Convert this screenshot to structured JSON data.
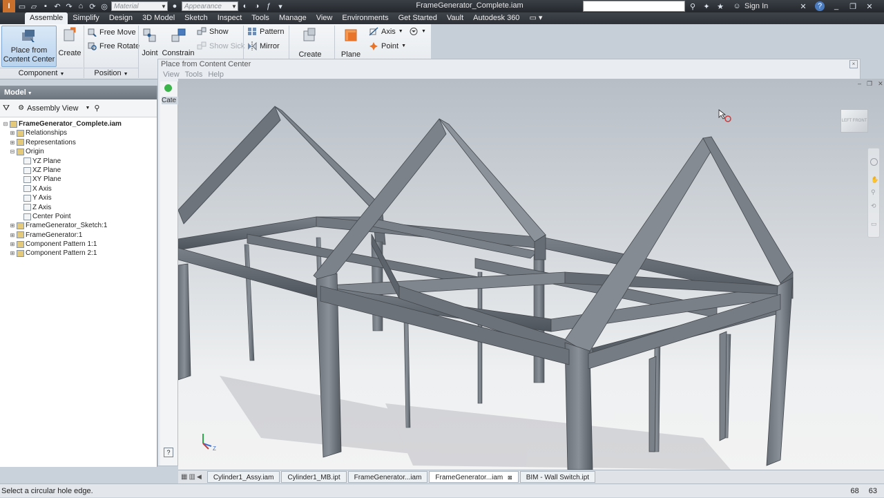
{
  "window": {
    "title": "FrameGenerator_Complete.iam",
    "sign_in": "Sign In",
    "material_placeholder": "Material",
    "appearance_placeholder": "Appearance"
  },
  "menu_tabs": [
    "Assemble",
    "Simplify",
    "Design",
    "3D Model",
    "Sketch",
    "Inspect",
    "Tools",
    "Manage",
    "View",
    "Environments",
    "Get Started",
    "Vault",
    "Autodesk 360"
  ],
  "ribbon": {
    "place_from_cc": "Place from Content Center",
    "create": "Create",
    "free_move": "Free Move",
    "free_rotate": "Free Rotate",
    "joint": "Joint",
    "constrain": "Constrain",
    "show": "Show",
    "show_sick": "Show Sick",
    "pattern": "Pattern",
    "mirror": "Mirror",
    "create2": "Create",
    "plane": "Plane",
    "axis": "Axis",
    "point": "Point",
    "panel_component": "Component",
    "panel_position": "Position"
  },
  "browser": {
    "header": "Model",
    "view_label": "Assembly View",
    "tree": [
      {
        "label": "FrameGenerator_Complete.iam",
        "indent": 0,
        "toggle": "-",
        "bold": true
      },
      {
        "label": "Relationships",
        "indent": 1,
        "toggle": "+"
      },
      {
        "label": "Representations",
        "indent": 1,
        "toggle": "+"
      },
      {
        "label": "Origin",
        "indent": 1,
        "toggle": "-"
      },
      {
        "label": "YZ Plane",
        "indent": 2,
        "toggle": ""
      },
      {
        "label": "XZ Plane",
        "indent": 2,
        "toggle": ""
      },
      {
        "label": "XY Plane",
        "indent": 2,
        "toggle": ""
      },
      {
        "label": "X Axis",
        "indent": 2,
        "toggle": ""
      },
      {
        "label": "Y Axis",
        "indent": 2,
        "toggle": ""
      },
      {
        "label": "Z Axis",
        "indent": 2,
        "toggle": ""
      },
      {
        "label": "Center Point",
        "indent": 2,
        "toggle": ""
      },
      {
        "label": "FrameGenerator_Sketch:1",
        "indent": 1,
        "toggle": "+"
      },
      {
        "label": "FrameGenerator:1",
        "indent": 1,
        "toggle": "+"
      },
      {
        "label": "Component Pattern 1:1",
        "indent": 1,
        "toggle": "+"
      },
      {
        "label": "Component Pattern 2:1",
        "indent": 1,
        "toggle": "+"
      }
    ]
  },
  "content_center": {
    "title": "Place from Content Center",
    "menu": [
      "View",
      "Tools",
      "Help"
    ],
    "category_stub": "Cate"
  },
  "viewcube": {
    "left": "LEFT",
    "front": "FRONT"
  },
  "doc_tabs": [
    "Cylinder1_Assy.iam",
    "Cylinder1_MB.ipt",
    "FrameGenerator...iam",
    "FrameGenerator...iam",
    "BIM - Wall Switch.ipt"
  ],
  "active_doc_tab": 3,
  "status": {
    "message": "Select a circular hole edge.",
    "num1": "68",
    "num2": "63"
  },
  "colors": {
    "accent": "#e8742a",
    "frame_steel": "#5a5f66"
  }
}
